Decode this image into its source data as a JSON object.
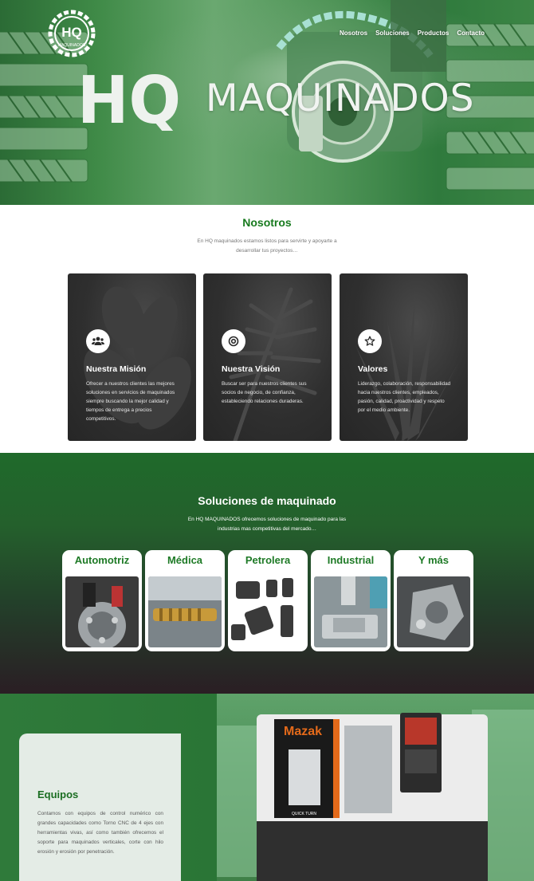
{
  "nav": {
    "items": [
      "Nosotros",
      "Soluciones",
      "Productos",
      "Contacto"
    ]
  },
  "hero": {
    "logo_text": "HQ",
    "logo_subtext": "MAQUINADOS",
    "brand_hq": "HQ",
    "brand_word": "MAQUINADOS"
  },
  "nosotros": {
    "title": "Nosotros",
    "intro": "En HQ maquinados estamos listos para servirte y apoyarte a desarrollar tus proyectos…",
    "cards": [
      {
        "icon": "users-icon",
        "title": "Nuestra Misión",
        "text": "Ofrecer a nuestros clientes las mejores soluciones en servicios de maquinados siempre buscando la mejor calidad y tiempos de entrega a precios competitivos."
      },
      {
        "icon": "target-icon",
        "title": "Nuestra Visión",
        "text": "Buscar ser para nuestros clientes sus socios de negocio, de confianza, estableciendo relaciones duraderas."
      },
      {
        "icon": "star-icon",
        "title": "Valores",
        "text": "Liderazgo, colaboración, responsabilidad hacia nuestros clientes, empleados, pasión, calidad, proactividad y respeto por el medio ambiente."
      }
    ]
  },
  "soluciones": {
    "title": "Soluciones de maquinado",
    "intro": "En HQ MAQUINADOS ofrecemos soluciones de maquinado para las industrias mas competitivas del mercado…",
    "industries": [
      "Automotriz",
      "Médica",
      "Petrolera",
      "Industrial",
      "Y más"
    ]
  },
  "equipos": {
    "title": "Equipos",
    "text": "Contamos con equipos de control numérico con grandes capacidades como Torno CNC de 4 ejes con herramientas vivas, así como también ofrecemos el soporte para maquinados verticales, corte con hilo erosión y erosión por penetración.",
    "machine_brand": "Mazak",
    "machine_model": "QUICK TURN"
  },
  "colors": {
    "accent_green": "#177a1e",
    "hero_green": "#3f8a47",
    "card_dark": "#2f2f2f"
  }
}
